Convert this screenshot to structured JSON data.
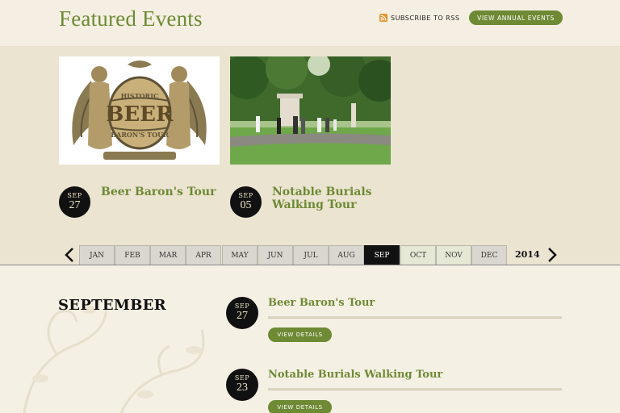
{
  "header": {
    "title": "Featured Events",
    "rss_label": "Subscribe to RSS",
    "annual_button": "View Annual Events"
  },
  "featured": [
    {
      "month": "SEP",
      "day": "27",
      "title": "Beer Baron's Tour",
      "image_text_top": "HISTORIC",
      "image_text_mid": "BEER",
      "image_text_bot": "BARON'S TOUR"
    },
    {
      "month": "SEP",
      "day": "05",
      "title": "Notable Burials Walking Tour"
    }
  ],
  "calendar": {
    "months": [
      "JAN",
      "FEB",
      "MAR",
      "APR",
      "MAY",
      "JUN",
      "JUL",
      "AUG",
      "SEP",
      "OCT",
      "NOV",
      "DEC"
    ],
    "active": "SEP",
    "year": "2014"
  },
  "listing": {
    "heading": "SEPTEMBER",
    "events": [
      {
        "month": "SEP",
        "day": "27",
        "title": "Beer Baron's Tour",
        "button": "View Details"
      },
      {
        "month": "SEP",
        "day": "23",
        "title": "Notable Burials Walking Tour",
        "button": "View Details"
      }
    ]
  },
  "colors": {
    "accent": "#6e8a34",
    "dark": "#111111",
    "band": "#ebe4d1",
    "background": "#f4efe2"
  },
  "icons": {
    "rss": "rss-icon",
    "prev": "chevron-left-icon",
    "next": "chevron-right-icon"
  }
}
